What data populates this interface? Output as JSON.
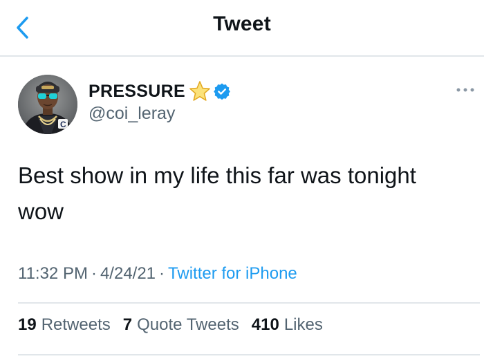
{
  "header": {
    "title": "Tweet",
    "back_icon": "chevron-left-icon"
  },
  "author": {
    "display_name": "PRESSURE",
    "handle": "@coi_leray",
    "emoji_icon": "star-icon",
    "verified_icon": "verified-badge-icon"
  },
  "tweet": {
    "text_line1": "Best show in my life this far was tonight",
    "text_line2": "wow"
  },
  "meta": {
    "time": "11:32 PM",
    "separator": "·",
    "date": "4/24/21",
    "source": "Twitter for iPhone"
  },
  "stats": {
    "retweets_count": "19",
    "retweets_label": "Retweets",
    "quote_count": "7",
    "quote_label": "Quote Tweets",
    "likes_count": "410",
    "likes_label": "Likes"
  },
  "colors": {
    "accent": "#1d9bf0",
    "secondary_text": "#536471",
    "primary_text": "#0f1419",
    "divider": "#e1e6ea",
    "star": "#f7c948"
  }
}
